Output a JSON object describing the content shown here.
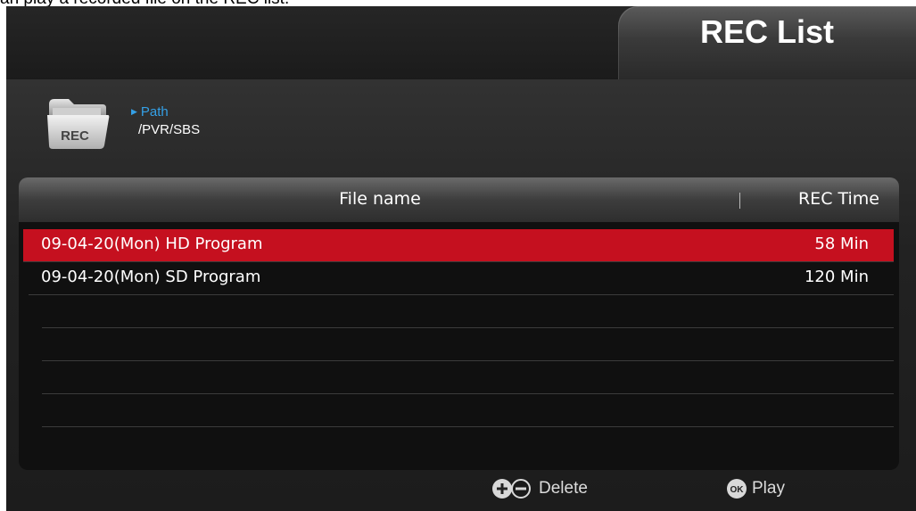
{
  "caption": "an play a recorded file on the REC list.",
  "header": {
    "title": "REC List"
  },
  "path": {
    "folder_label": "REC",
    "label": "Path",
    "value": "/PVR/SBS"
  },
  "list": {
    "columns": {
      "file_name": "File name",
      "rec_time": "REC Time"
    },
    "rows": [
      {
        "name": "09-04-20(Mon) HD Program",
        "time": "58 Min",
        "selected": true
      },
      {
        "name": "09-04-20(Mon) SD Program",
        "time": "120 Min",
        "selected": false
      }
    ]
  },
  "footer": {
    "delete_label": "Delete",
    "ok_icon_text": "OK",
    "play_label": "Play"
  },
  "colors": {
    "selected_row": "#c5101f",
    "path_label": "#34a0e6",
    "background": "#1c1c1c"
  },
  "icons": [
    "folder-icon",
    "triangle-right-icon",
    "plus-icon",
    "minus-icon",
    "ok-icon"
  ]
}
